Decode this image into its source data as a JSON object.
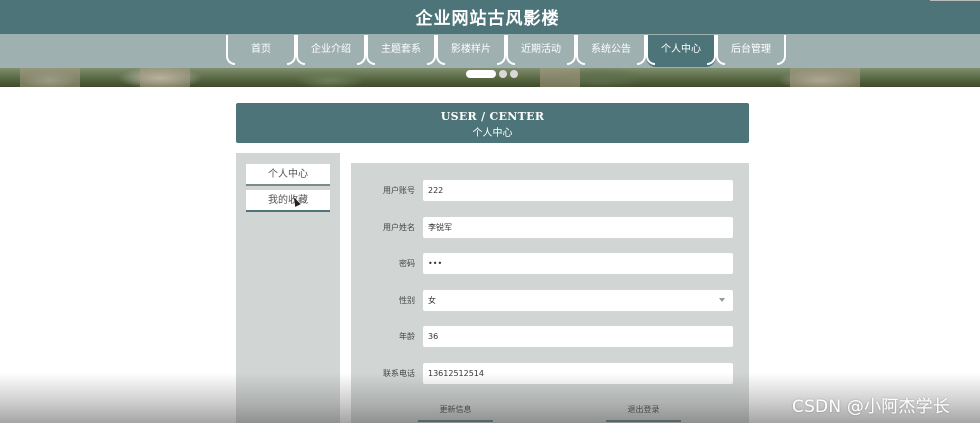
{
  "site": {
    "title": "企业网站古风影楼"
  },
  "nav": {
    "items": [
      "首页",
      "企业介绍",
      "主题套系",
      "影楼样片",
      "近期活动",
      "系统公告",
      "个人中心",
      "后台管理"
    ],
    "active_index": 6
  },
  "banner": {
    "slides": 3,
    "active_slide": 0
  },
  "center_header": {
    "en": "USER / CENTER",
    "zh": "个人中心"
  },
  "sidebar": {
    "items": [
      "个人中心",
      "我的收藏"
    ]
  },
  "form": {
    "fields": [
      {
        "label": "用户账号",
        "value": "222"
      },
      {
        "label": "用户姓名",
        "value": "李锐军"
      },
      {
        "label": "密码",
        "value": "•••"
      },
      {
        "label": "性别",
        "value": "女"
      },
      {
        "label": "年龄",
        "value": "36"
      },
      {
        "label": "联系电话",
        "value": "13612512514"
      }
    ],
    "update_label": "更新信息",
    "logout_label": "退出登录"
  },
  "watermark": "CSDN @小阿杰学长",
  "colors": {
    "primary": "#4d7479",
    "nav_bg": "#9fb0b1",
    "panel_bg": "#d1d5d4"
  }
}
